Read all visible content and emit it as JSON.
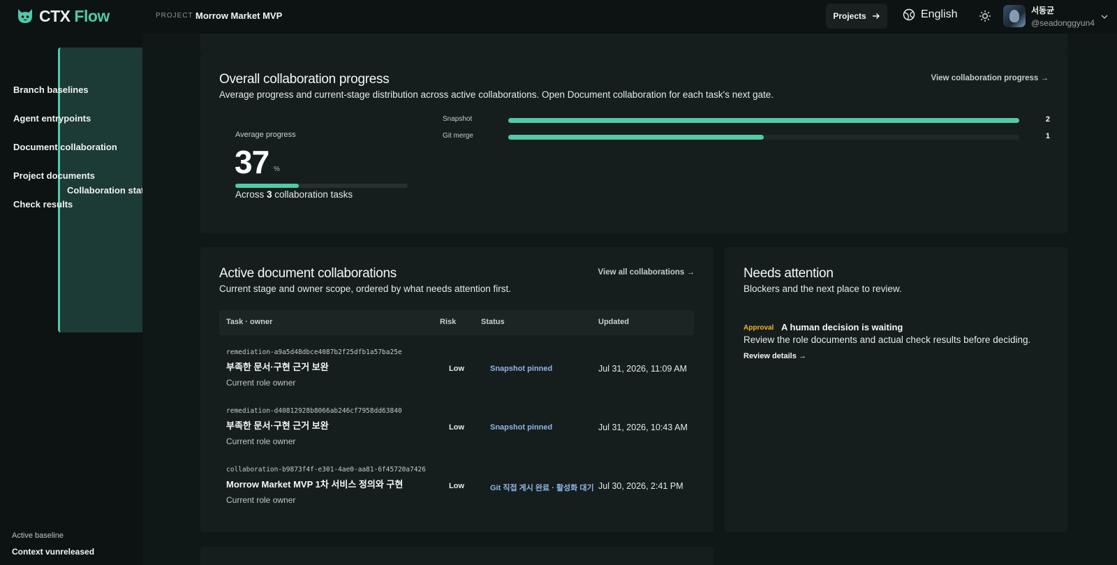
{
  "brand": {
    "ctx": "CTX",
    "flow": "Flow"
  },
  "header": {
    "project_label": "PROJECT",
    "project_name": "Morrow Market MVP",
    "projects_button": "Projects",
    "language": "English",
    "user_name": "서동균",
    "user_handle": "@seadonggyun4"
  },
  "sidebar": {
    "items": [
      {
        "label": "Collaboration status",
        "active": true
      },
      {
        "label": "Branch baselines"
      },
      {
        "label": "Agent entrypoints"
      },
      {
        "label": "Document collaboration"
      },
      {
        "label": "Project documents"
      },
      {
        "label": "Check results"
      }
    ],
    "footer_label": "Active baseline",
    "footer_value": "Context vunreleased"
  },
  "overall": {
    "title": "Overall collaboration progress",
    "description": "Average progress and current-stage distribution across active collaborations. Open Document collaboration for each task's next gate.",
    "link": "View collaboration progress →",
    "avg_label": "Average progress",
    "avg_value": "37",
    "avg_unit": "%",
    "avg_fraction": 0.37,
    "across_prefix": "Across ",
    "across_count": "3",
    "across_suffix": " collaboration tasks",
    "stages": [
      {
        "name": "Snapshot",
        "count": "2",
        "fraction": 1.0
      },
      {
        "name": "Git merge",
        "count": "1",
        "fraction": 0.5
      }
    ]
  },
  "active": {
    "title": "Active document collaborations",
    "description": "Current stage and owner scope, ordered by what needs attention first.",
    "link": "View all collaborations →",
    "columns": {
      "task": "Task · owner",
      "risk": "Risk",
      "status": "Status",
      "updated": "Updated"
    },
    "rows": [
      {
        "id": "remediation-a9a5d48dbce4087b2f25dfb1a57ba25e",
        "title": "부족한 문서·구현 근거 보완",
        "owner": "Current role owner",
        "risk": "Low",
        "status": "Snapshot pinned",
        "updated": "Jul 31, 2026, 11:09 AM"
      },
      {
        "id": "remediation-d40812928b8066ab246cf7958dd63840",
        "title": "부족한 문서·구현 근거 보완",
        "owner": "Current role owner",
        "risk": "Low",
        "status": "Snapshot pinned",
        "updated": "Jul 31, 2026, 10:43 AM"
      },
      {
        "id": "collaboration-b9873f4f-e301-4ae0-aa81-6f45720a7426",
        "title": "Morrow Market MVP 1차 서비스 정의와 구현",
        "owner": "Current role owner",
        "risk": "Low",
        "status": "Git 직접 게시 완료 · 활성화 대기",
        "updated": "Jul 30, 2026, 2:41 PM"
      }
    ]
  },
  "attention": {
    "title": "Needs attention",
    "description": "Blockers and the next place to review.",
    "item": {
      "badge": "Approval",
      "title": "A human decision is waiting",
      "description": "Review the role documents and actual check results before deciding.",
      "link": "Review details →"
    }
  },
  "colors": {
    "accent": "#52c9a9",
    "status_link": "#8fb6e8",
    "approval": "#f0b429",
    "background": "#0c1312",
    "card": "#151e1d"
  }
}
